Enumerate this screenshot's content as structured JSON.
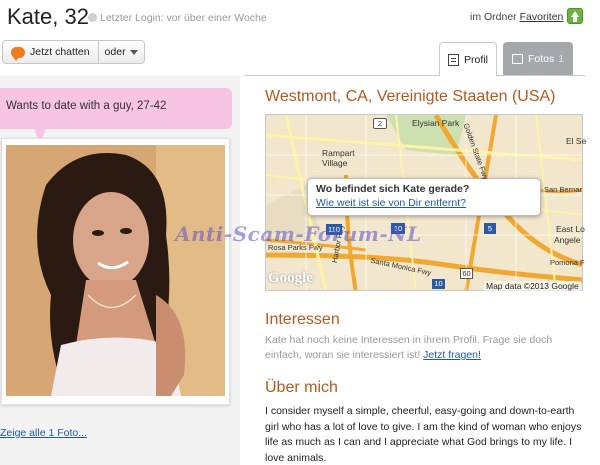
{
  "profile": {
    "name": "Kate, 32",
    "last_login": "Letzter Login: vor über einer Woche",
    "folder_prefix": "im Ordner",
    "folder_link": "Favoriten"
  },
  "actions": {
    "chat_label": "Jetzt chatten",
    "or_label": "oder"
  },
  "tabs": [
    {
      "label": "Profil",
      "icon": "profile-icon",
      "active": true
    },
    {
      "label": "Fotos",
      "count": "1",
      "icon": "photos-icon",
      "active": false
    }
  ],
  "left": {
    "bubble_text": "Wants to date with a guy, 27-42",
    "photo_link": "Zeige alle 1 Foto..."
  },
  "location": {
    "title": "Westmont, CA, Vereinigte Staaten (USA)",
    "popup_title": "Wo befindet sich Kate gerade?",
    "popup_link": "Wie weit ist sie von Dir entfernt?",
    "map_brand": "Google",
    "map_credit": "Map data ©2013 Google",
    "map_labels": [
      "Elysian Park",
      "Rampart Village",
      "El Se",
      "San Bernar",
      "East Lo",
      "Angele",
      "Rosa Parks Fwy",
      "Santa Monica Fwy",
      "Harbor Fwy",
      "Pomona F",
      "Golden State Fwy"
    ],
    "map_shields": [
      "2",
      "5",
      "10",
      "110",
      "60",
      "10"
    ]
  },
  "watermark": "Anti-Scam-Forum-NL",
  "interests": {
    "title": "Interessen",
    "text": "Kate hat noch keine Interessen in ihrem Profil. Frage sie doch einfach, woran sie interessiert ist!",
    "link": "Jetzt fragen!"
  },
  "about": {
    "title": "Über mich",
    "text": "I consider myself a simple, cheerful, easy-going and down-to-earth girl who has a lot of love to give. I am the kind of woman who enjoys life as much as I can and I appreciate what God brings to my life. I love animals."
  },
  "colors": {
    "accent": "#b45a1f",
    "link": "#1f5aa6",
    "bubble": "#f7c4e4",
    "tab_inactive": "#a5a8ab",
    "chat_orange": "#f27a1a",
    "favorite_green": "#6cb33f"
  }
}
